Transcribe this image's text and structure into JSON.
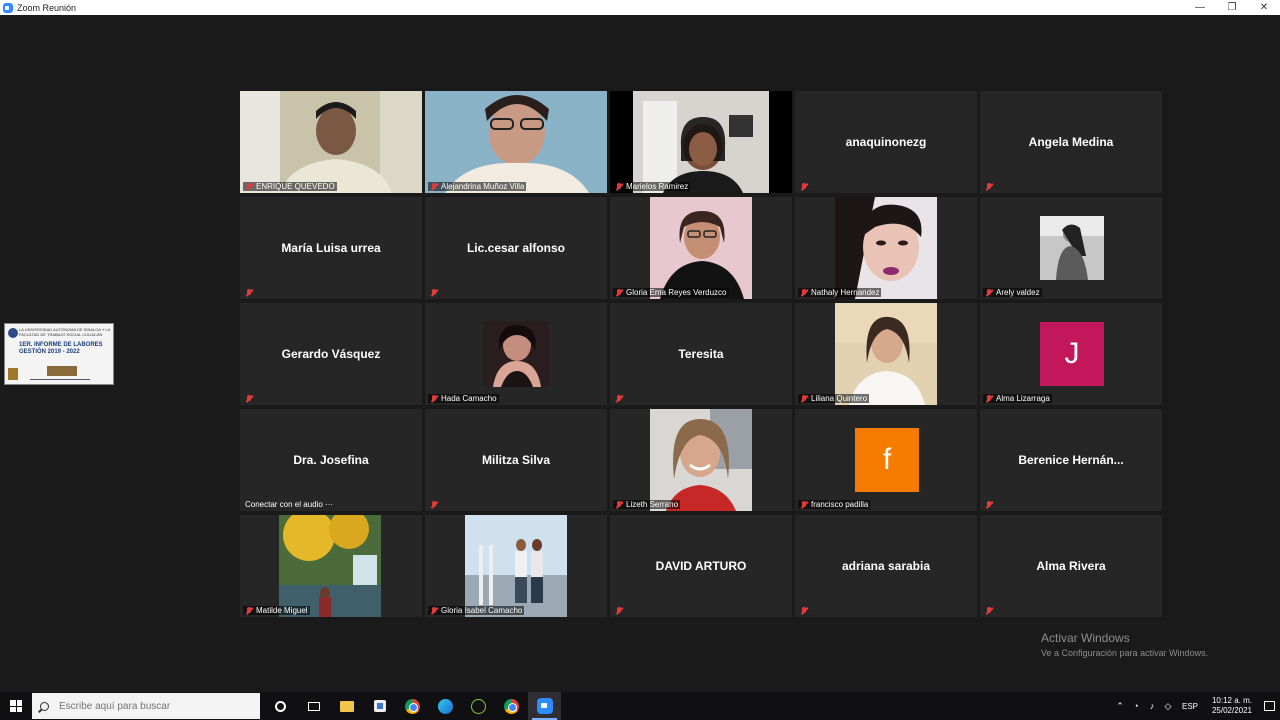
{
  "window": {
    "title": "Zoom Reunión",
    "controls": {
      "minimize": "—",
      "restore": "❐",
      "close": "✕"
    }
  },
  "share_thumbnail": {
    "line1": "LA UNIVERSIDAD AUTÓNOMA DE SINALOA Y LA",
    "line2": "FACULTAD DE TRABAJO SOCIAL CULIACÁN",
    "heading1": "1ER. INFORME DE LABORES",
    "heading2": "GESTIÓN 2019 - 2022"
  },
  "participants": [
    {
      "name": "ENRIQUE QUEVEDO",
      "type": "video"
    },
    {
      "name": "Alejandrina Muñoz Villa",
      "type": "video"
    },
    {
      "name": "Marielos Ramirez",
      "type": "video"
    },
    {
      "name": "anaquinonezg",
      "type": "name"
    },
    {
      "name": "Angela Medina",
      "type": "name"
    },
    {
      "name": "María Luisa urrea",
      "type": "name"
    },
    {
      "name": "Lic.cesar alfonso",
      "type": "name"
    },
    {
      "name": "Gloria Ema Reyes Verduzco",
      "type": "photo"
    },
    {
      "name": "Nathaly Hernandez",
      "type": "photo"
    },
    {
      "name": "Arely valdez",
      "type": "photo"
    },
    {
      "name": "Gerardo Vásquez",
      "type": "name"
    },
    {
      "name": "Hada Camacho",
      "type": "photo"
    },
    {
      "name": "Teresita",
      "type": "name"
    },
    {
      "name": "Liliana Quintero",
      "type": "photo"
    },
    {
      "name": "Alma Lizarraga",
      "type": "avatar",
      "letter": "J",
      "color": "#c2185b"
    },
    {
      "name": "Dra. Josefina",
      "type": "name",
      "audio_label": "Conectar con el audio ···"
    },
    {
      "name": "Militza Silva",
      "type": "name"
    },
    {
      "name": "Lizeth Serrano",
      "type": "photo"
    },
    {
      "name": "francisco padilla",
      "type": "avatar",
      "letter": "f",
      "color": "#f57c00"
    },
    {
      "name": "Berenice  Hernán...",
      "type": "name"
    },
    {
      "name": "Matilde Miguel",
      "type": "photo"
    },
    {
      "name": "Gloria  Isabel Camacho",
      "type": "photo"
    },
    {
      "name": "DAVID ARTURO",
      "type": "name"
    },
    {
      "name": "adriana sarabia",
      "type": "name"
    },
    {
      "name": "Alma Rivera",
      "type": "name"
    }
  ],
  "watermark": {
    "line1": "Activar Windows",
    "line2": "Ve a Configuración para activar Windows."
  },
  "taskbar": {
    "search_placeholder": "Escribe aquí para buscar",
    "language": "ESP",
    "time": "10:12 a. m.",
    "date": "25/02/2021"
  }
}
